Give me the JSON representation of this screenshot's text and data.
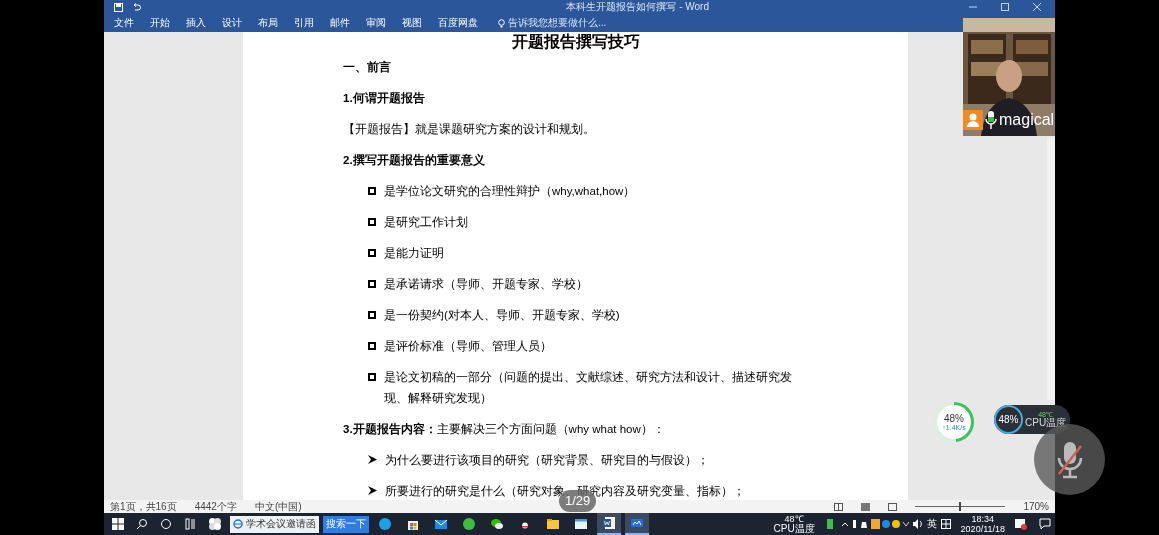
{
  "window": {
    "title": "本科生开题报告如何撰写 - Word"
  },
  "ribbon_tabs": [
    {
      "label": "文件"
    },
    {
      "label": "开始"
    },
    {
      "label": "插入"
    },
    {
      "label": "设计"
    },
    {
      "label": "布局"
    },
    {
      "label": "引用"
    },
    {
      "label": "邮件"
    },
    {
      "label": "审阅"
    },
    {
      "label": "视图"
    },
    {
      "label": "百度网盘"
    }
  ],
  "tell_me": {
    "placeholder": "告诉我您想要做什么..."
  },
  "document": {
    "title": "开题报告撰写技巧",
    "paragraphs": [
      {
        "kind": "heading",
        "text": "一、前言"
      },
      {
        "kind": "heading",
        "text": "1.何谓开题报告"
      },
      {
        "kind": "text",
        "text": "【开题报告】就是课题研究方案的设计和规划。"
      },
      {
        "kind": "heading",
        "text": "2.撰写开题报告的重要意义"
      },
      {
        "kind": "box",
        "text": "是学位论文研究的合理性辩护（why,what,how）"
      },
      {
        "kind": "box",
        "text": "是研究工作计划"
      },
      {
        "kind": "box",
        "text": "是能力证明"
      },
      {
        "kind": "box",
        "text": "是承诺请求（导师、开题专家、学校）"
      },
      {
        "kind": "box",
        "text": "是一份契约(对本人、导师、开题专家、学校)"
      },
      {
        "kind": "box",
        "text": "是评价标准（导师、管理人员）"
      },
      {
        "kind": "box",
        "text": "是论文初稿的一部分（问题的提出、文献综述、研究方法和设计、描述研究发现、解释研究发现）"
      },
      {
        "kind": "text",
        "text": "**3.开题报告内容：**主要解决三个方面问题（why what how）："
      },
      {
        "kind": "arrow",
        "text": "为什么要进行该项目的研究（研究背景、研究目的与假设）；"
      },
      {
        "kind": "arrow",
        "text": "所要进行的研究是什么（研究对象、研究内容及研究变量、指标）；"
      }
    ]
  },
  "status_bar": {
    "items": [
      "第1页，共16页",
      "4442个字",
      "中文(中国)"
    ],
    "zoom": {
      "level": 0.5,
      "reading": "170%"
    }
  },
  "page_indicator": "1/29",
  "video": {
    "name": "magical"
  },
  "widgets": {
    "network": {
      "reading": "48%",
      "speed": "↑1.4K/s"
    },
    "cpu": {
      "reading": "48%",
      "temp": "48℃",
      "label": "CPU温度"
    }
  },
  "mute_button": {
    "muted": true
  },
  "taskbar": {
    "search": {
      "value": "学术会议邀请函",
      "button": "搜索一下"
    },
    "apps": [
      {
        "kind": "edge",
        "active": false
      },
      {
        "kind": "store",
        "active": false
      },
      {
        "kind": "mail",
        "active": false
      },
      {
        "kind": "green",
        "active": false
      },
      {
        "kind": "wechat",
        "active": false
      },
      {
        "kind": "qq",
        "active": false
      },
      {
        "kind": "folder",
        "active": false
      },
      {
        "kind": "window",
        "active": false
      },
      {
        "kind": "word",
        "active": true
      },
      {
        "kind": "meeting",
        "active": true
      }
    ],
    "tray": {
      "temp": "48℃",
      "label": "CPU温度",
      "ime": "英",
      "time": "18:34",
      "date": "2020/11/18"
    }
  }
}
